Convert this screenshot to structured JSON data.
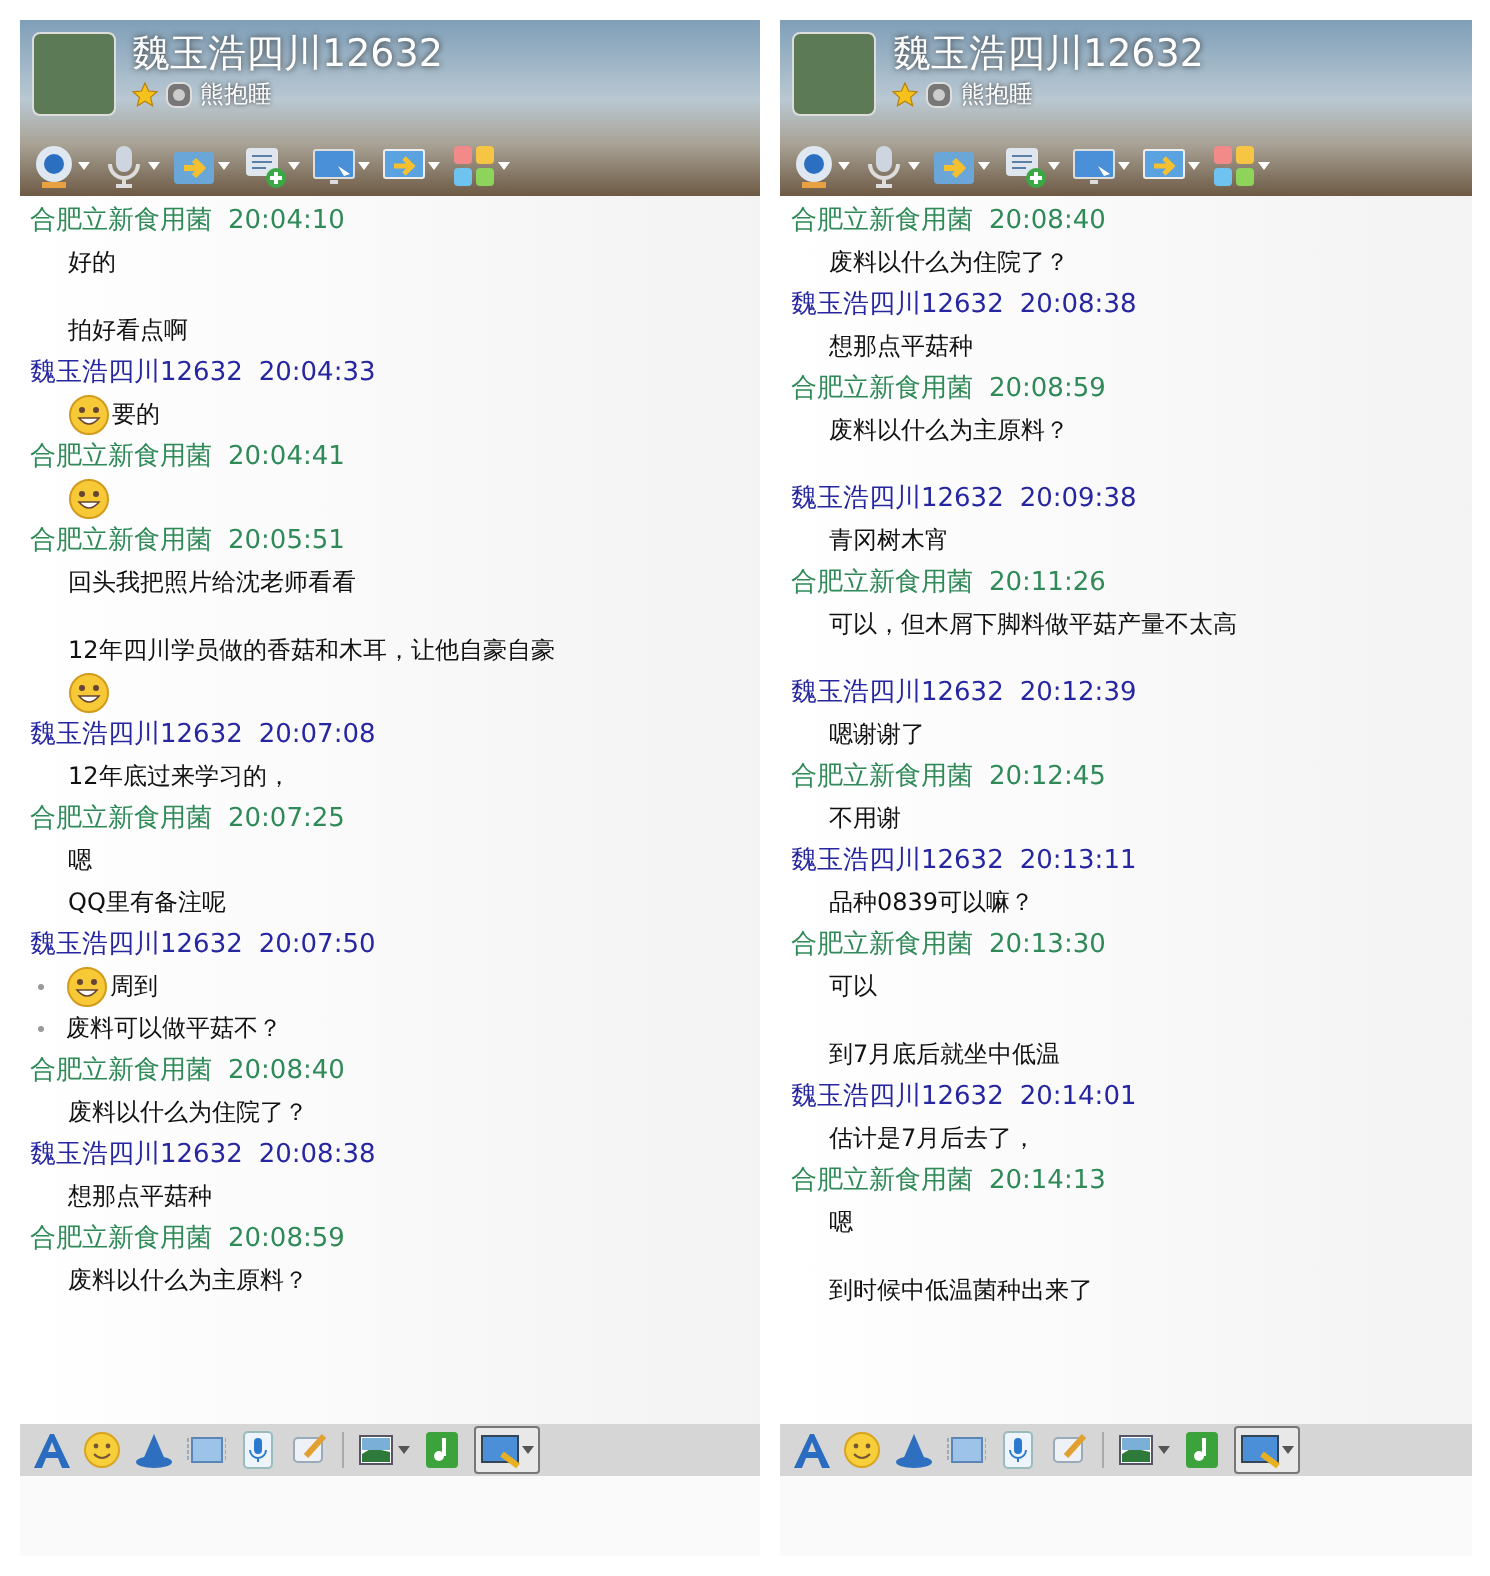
{
  "windows": [
    {
      "title": "魏玉浩四川12632",
      "status": "熊抱睡",
      "messages": [
        {
          "kind": "header",
          "color": "#2f8a58",
          "sender": "合肥立新食用菌",
          "time": "20:04:10"
        },
        {
          "kind": "text",
          "text": "好的",
          "bullet": false
        },
        {
          "kind": "blank"
        },
        {
          "kind": "text",
          "text": "拍好看点啊",
          "bullet": false
        },
        {
          "kind": "header",
          "color": "#2626a0",
          "sender": "魏玉浩四川12632",
          "time": "20:04:33"
        },
        {
          "kind": "emoji",
          "text": "要的",
          "bullet": false
        },
        {
          "kind": "header",
          "color": "#2f8a58",
          "sender": "合肥立新食用菌",
          "time": "20:04:41"
        },
        {
          "kind": "emoji",
          "bullet": false
        },
        {
          "kind": "header",
          "color": "#2f8a58",
          "sender": "合肥立新食用菌",
          "time": "20:05:51"
        },
        {
          "kind": "text",
          "text": "回头我把照片给沈老师看看",
          "bullet": false
        },
        {
          "kind": "blank"
        },
        {
          "kind": "text",
          "text": "12年四川学员做的香菇和木耳，让他自豪自豪",
          "bullet": false
        },
        {
          "kind": "emoji",
          "bullet": false
        },
        {
          "kind": "header",
          "color": "#2626a0",
          "sender": "魏玉浩四川12632",
          "time": "20:07:08"
        },
        {
          "kind": "text",
          "text": "12年底过来学习的，",
          "bullet": false
        },
        {
          "kind": "header",
          "color": "#2f8a58",
          "sender": "合肥立新食用菌",
          "time": "20:07:25"
        },
        {
          "kind": "text",
          "text": "嗯",
          "bullet": false
        },
        {
          "kind": "text",
          "text": "QQ里有备注呢",
          "bullet": false
        },
        {
          "kind": "header",
          "color": "#2626a0",
          "sender": "魏玉浩四川12632",
          "time": "20:07:50"
        },
        {
          "kind": "emoji",
          "text": "周到",
          "bullet": true
        },
        {
          "kind": "text",
          "text": "废料可以做平菇不？",
          "bullet": true
        },
        {
          "kind": "header",
          "color": "#2f8a58",
          "sender": "合肥立新食用菌",
          "time": "20:08:40"
        },
        {
          "kind": "text",
          "text": "废料以什么为住院了？",
          "bullet": false
        },
        {
          "kind": "header",
          "color": "#2626a0",
          "sender": "魏玉浩四川12632",
          "time": "20:08:38"
        },
        {
          "kind": "text",
          "text": "想那点平菇种",
          "bullet": false
        },
        {
          "kind": "header",
          "color": "#2f8a58",
          "sender": "合肥立新食用菌",
          "time": "20:08:59"
        },
        {
          "kind": "text",
          "text": "废料以什么为主原料？",
          "bullet": false
        }
      ]
    },
    {
      "title": "魏玉浩四川12632",
      "status": "熊抱睡",
      "messages": [
        {
          "kind": "header",
          "color": "#2f8a58",
          "sender": "合肥立新食用菌",
          "time": "20:08:40"
        },
        {
          "kind": "text",
          "text": "废料以什么为住院了？",
          "bullet": false
        },
        {
          "kind": "header",
          "color": "#2626a0",
          "sender": "魏玉浩四川12632",
          "time": "20:08:38"
        },
        {
          "kind": "text",
          "text": "想那点平菇种",
          "bullet": false
        },
        {
          "kind": "header",
          "color": "#2f8a58",
          "sender": "合肥立新食用菌",
          "time": "20:08:59"
        },
        {
          "kind": "text",
          "text": "废料以什么为主原料？",
          "bullet": false
        },
        {
          "kind": "blank"
        },
        {
          "kind": "header",
          "color": "#2626a0",
          "sender": "魏玉浩四川12632",
          "time": "20:09:38"
        },
        {
          "kind": "text",
          "text": "青冈树木宵",
          "bullet": false
        },
        {
          "kind": "header",
          "color": "#2f8a58",
          "sender": "合肥立新食用菌",
          "time": "20:11:26"
        },
        {
          "kind": "text",
          "text": "可以，但木屑下脚料做平菇产量不太高",
          "bullet": false
        },
        {
          "kind": "blank"
        },
        {
          "kind": "header",
          "color": "#2626a0",
          "sender": "魏玉浩四川12632",
          "time": "20:12:39"
        },
        {
          "kind": "text",
          "text": "嗯谢谢了",
          "bullet": false
        },
        {
          "kind": "header",
          "color": "#2f8a58",
          "sender": "合肥立新食用菌",
          "time": "20:12:45"
        },
        {
          "kind": "text",
          "text": "不用谢",
          "bullet": false
        },
        {
          "kind": "header",
          "color": "#2626a0",
          "sender": "魏玉浩四川12632",
          "time": "20:13:11"
        },
        {
          "kind": "text",
          "text": "品种0839可以嘛？",
          "bullet": false
        },
        {
          "kind": "header",
          "color": "#2f8a58",
          "sender": "合肥立新食用菌",
          "time": "20:13:30"
        },
        {
          "kind": "text",
          "text": "可以",
          "bullet": false
        },
        {
          "kind": "blank"
        },
        {
          "kind": "text",
          "text": "到7月底后就坐中低温",
          "bullet": false
        },
        {
          "kind": "header",
          "color": "#2626a0",
          "sender": "魏玉浩四川12632",
          "time": "20:14:01"
        },
        {
          "kind": "text",
          "text": "估计是7月后去了，",
          "bullet": false
        },
        {
          "kind": "header",
          "color": "#2f8a58",
          "sender": "合肥立新食用菌",
          "time": "20:14:13"
        },
        {
          "kind": "text",
          "text": "嗯",
          "bullet": false
        },
        {
          "kind": "blank"
        },
        {
          "kind": "text",
          "text": "到时候中低温菌种出来了",
          "bullet": false
        }
      ]
    }
  ]
}
